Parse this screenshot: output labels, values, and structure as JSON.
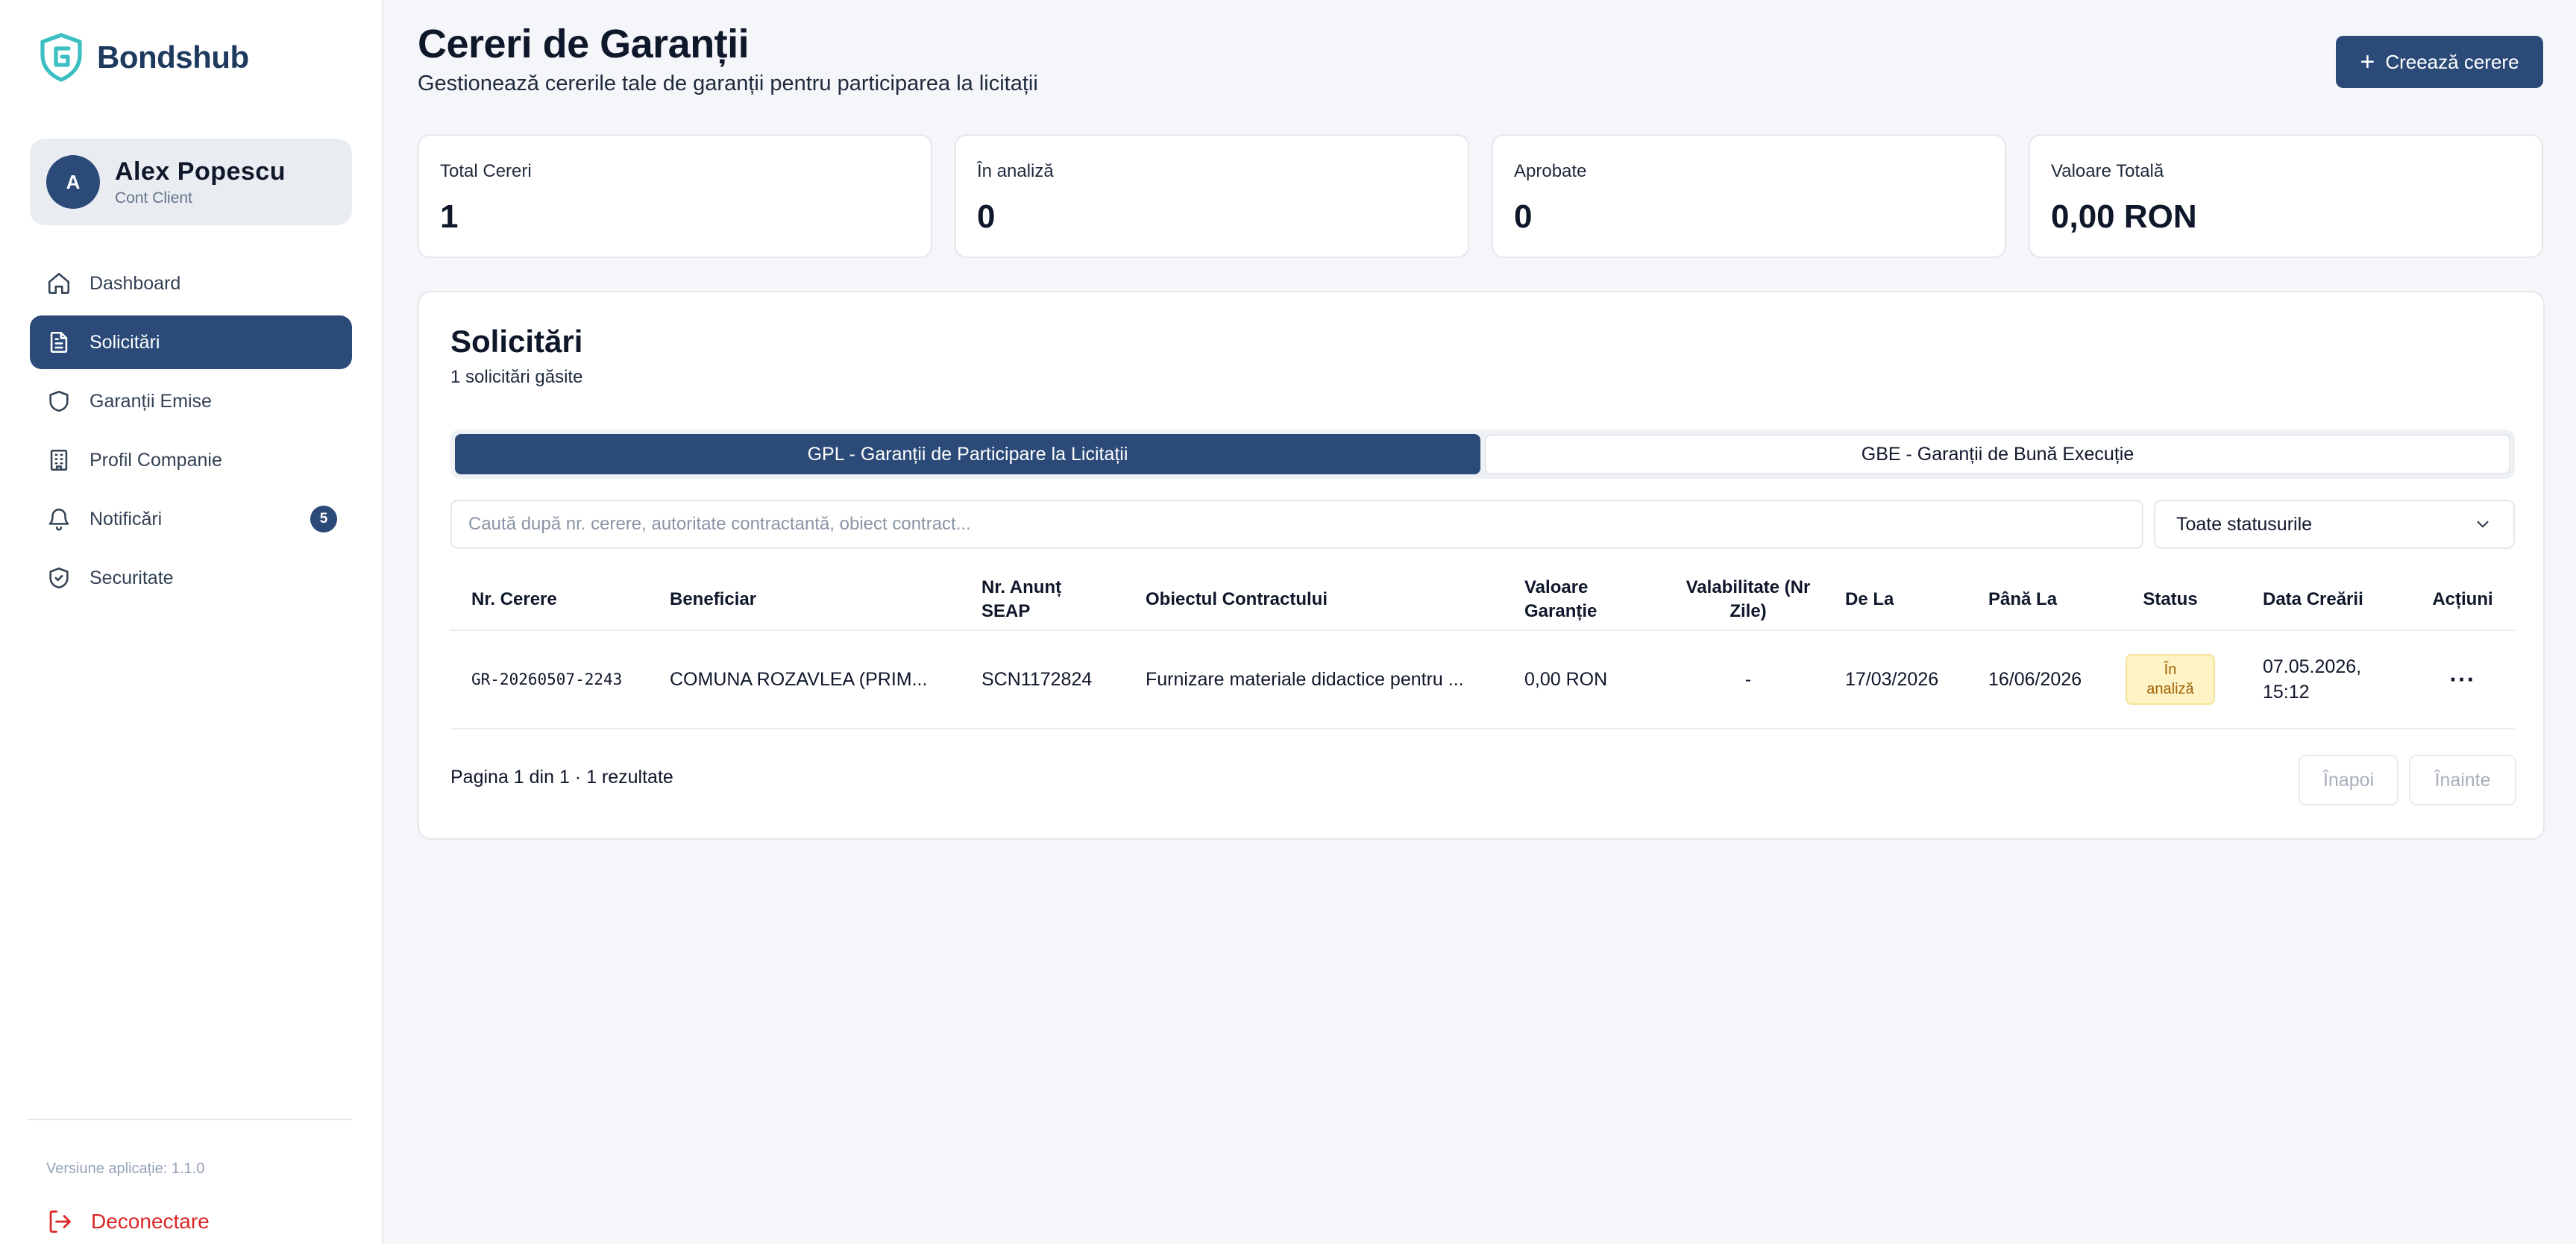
{
  "brand": {
    "name": "Bondshub",
    "color": "#2b4a78",
    "logo_accent": "#3bbfc2"
  },
  "user": {
    "initial": "A",
    "name": "Alex Popescu",
    "role": "Cont Client"
  },
  "nav": {
    "items": [
      {
        "label": "Dashboard",
        "icon": "home-icon"
      },
      {
        "label": "Solicitări",
        "icon": "document-icon",
        "active": true
      },
      {
        "label": "Garanții Emise",
        "icon": "shield-icon"
      },
      {
        "label": "Profil Companie",
        "icon": "building-icon"
      },
      {
        "label": "Notificări",
        "icon": "bell-icon",
        "badge": "5"
      },
      {
        "label": "Securitate",
        "icon": "shield-check-icon"
      }
    ]
  },
  "footer": {
    "version": "Versiune aplicație: 1.1.0",
    "logout": "Deconectare"
  },
  "header": {
    "title": "Cereri de Garanții",
    "subtitle": "Gestionează cererile tale de garanții pentru participarea la licitații",
    "create_button": "Creează cerere"
  },
  "stats": [
    {
      "label": "Total Cereri",
      "value": "1"
    },
    {
      "label": "În analiză",
      "value": "0"
    },
    {
      "label": "Aprobate",
      "value": "0"
    },
    {
      "label": "Valoare Totală",
      "value": "0,00 RON"
    }
  ],
  "panel": {
    "title": "Solicitări",
    "subtitle": "1 solicitări găsite",
    "tabs": [
      {
        "label": "GPL - Garanții de Participare la Licitații",
        "active": true
      },
      {
        "label": "GBE - Garanții de Bună Execuție",
        "active": false
      }
    ],
    "search_placeholder": "Caută după nr. cerere, autoritate contractantă, obiect contract...",
    "status_filter": "Toate statusurile"
  },
  "table": {
    "headers": [
      "Nr. Cerere",
      "Beneficiar",
      "Nr. Anunț SEAP",
      "Obiectul Contractului",
      "Valoare Garanție",
      "Valabilitate (Nr Zile)",
      "De La",
      "Până La",
      "Status",
      "Data Creării",
      "Acțiuni"
    ],
    "rows": [
      {
        "nr": "GR-20260507-2243",
        "beneficiar": "COMUNA ROZAVLEA (PRIM...",
        "seap": "SCN1172824",
        "obiect": "Furnizare materiale didactice pentru ...",
        "valoare": "0,00 RON",
        "valabilitate": "-",
        "de_la": "17/03/2026",
        "pana_la": "16/06/2026",
        "status": "În analiză",
        "data_crearii": "07.05.2026, 15:12",
        "actions": "···"
      }
    ]
  },
  "pagination": {
    "info": "Pagina 1 din 1 · 1 rezultate",
    "prev": "Înapoi",
    "next": "Înainte"
  }
}
